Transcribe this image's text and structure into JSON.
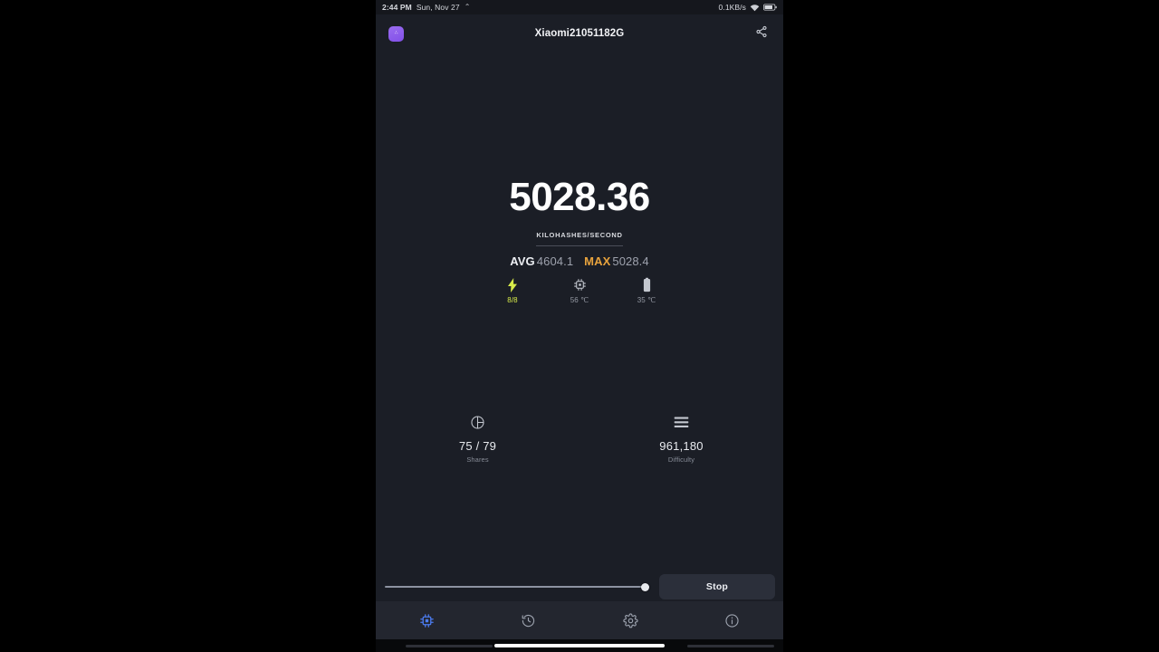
{
  "status_bar": {
    "time": "2:44 PM",
    "date": "Sun, Nov 27",
    "left_glyph": "⌃",
    "network_speed": "0.1KB/s",
    "wifi_icon": "wifi-icon",
    "battery_icon": "battery-icon"
  },
  "header": {
    "app_icon_label": "app-icon",
    "app_icon_text": "∴",
    "title": "Xiaomi21051182G",
    "share_icon": "share-icon"
  },
  "hashrate": {
    "value": "5028.36",
    "unit": "KILOHASHES/SECOND",
    "avg_label": "AVG",
    "avg_value": "4604.1",
    "max_label": "MAX",
    "max_value": "5028.4",
    "max_color": "#e8a33d"
  },
  "device_stats": [
    {
      "name": "threads",
      "icon": "lightning-bolt-icon",
      "value": "8/8",
      "color": "#d8ec4a"
    },
    {
      "name": "cpu-temperature",
      "icon": "cpu-chip-icon",
      "value": "56 ℃",
      "color": "#9499a3"
    },
    {
      "name": "battery-temperature",
      "icon": "battery-icon",
      "value": "35 ℃",
      "color": "#9499a3"
    }
  ],
  "kpis": [
    {
      "name": "shares",
      "icon": "pie-chart-icon",
      "value": "75 / 79",
      "label": "Shares"
    },
    {
      "name": "difficulty",
      "icon": "layers-icon",
      "value": "961,180",
      "label": "Difficulty"
    }
  ],
  "controls": {
    "slider_name": "threads-slider",
    "slider_percent": 98,
    "stop_label": "Stop"
  },
  "bottom_nav": [
    {
      "name": "miner",
      "icon": "cpu-chip-icon",
      "active": true,
      "color": "#4c7cf0"
    },
    {
      "name": "history",
      "icon": "history-clock-icon",
      "active": false,
      "color": "#9da3af"
    },
    {
      "name": "settings",
      "icon": "gear-icon",
      "active": false,
      "color": "#9da3af"
    },
    {
      "name": "info",
      "icon": "info-circle-icon",
      "active": false,
      "color": "#9da3af"
    }
  ]
}
